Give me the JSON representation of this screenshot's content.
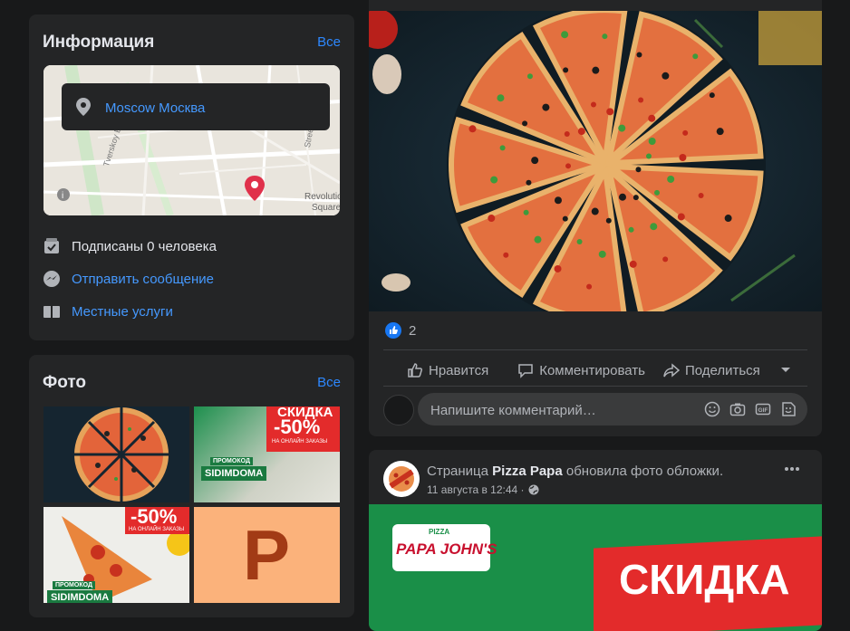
{
  "info": {
    "title": "Информация",
    "see_all": "Все",
    "map_location": "Moscow Москва",
    "map_labels": [
      "Tverskoy Blvd",
      "Street",
      "Revolution",
      "Square"
    ],
    "subscribers": "Подписаны 0 человека",
    "send_message": "Отправить сообщение",
    "local_services": "Местные услуги"
  },
  "photos": {
    "title": "Фото",
    "see_all": "Все",
    "thumb2": {
      "big": "СКИДКА",
      "pct": "-50%",
      "sub": "НА ОНЛАЙН ЗАКАЗЫ",
      "promo": "ПРОМОКОД",
      "code": "SIDIMDOMA"
    },
    "thumb3": {
      "pct": "-50%",
      "sub": "НА ОНЛАЙН ЗАКАЗЫ",
      "promo": "ПРОМОКОД",
      "code": "SIDIMDOMA"
    },
    "thumb4": {
      "letter": "P"
    }
  },
  "post1": {
    "like_count": "2",
    "like": "Нравится",
    "comment": "Комментировать",
    "share": "Поделиться",
    "comment_placeholder": "Напишите комментарий…"
  },
  "post2": {
    "prefix": "Страница",
    "page_name": "Pizza Papa",
    "suffix": "обновила фото обложки.",
    "time": "11 августа в 12:44 ·",
    "brand_top": "PIZZA",
    "brand": "PAPA JOHN'S",
    "banner": "СКИДКА"
  },
  "colors": {
    "background": "#18191a",
    "card": "#242526",
    "link": "#4599ff",
    "see_all": "#2d88ff",
    "promo_red": "#e32b2b",
    "promo_green": "#1a8f48"
  },
  "icons": [
    "location-pin-icon",
    "subscribers-icon",
    "messenger-icon",
    "services-icon",
    "like-thumb-icon",
    "comment-icon",
    "share-icon",
    "chevron-down-icon",
    "emoji-icon",
    "camera-icon",
    "gif-icon",
    "sticker-icon",
    "globe-icon",
    "more-icon",
    "info-icon"
  ]
}
